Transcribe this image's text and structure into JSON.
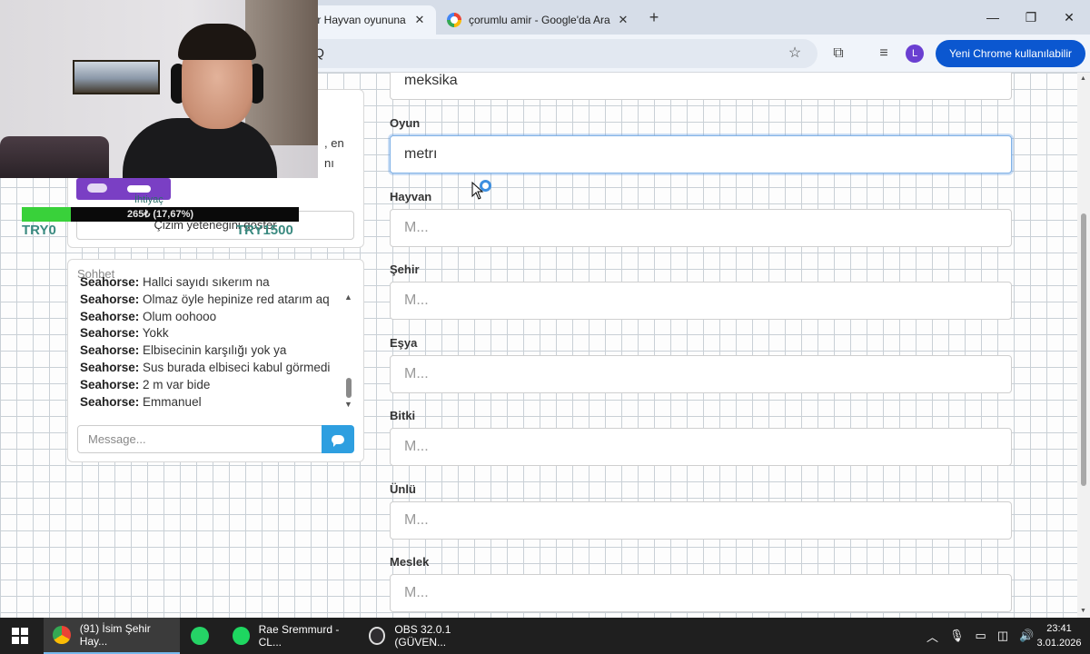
{
  "browser": {
    "tabs": [
      {
        "title": "hir Hayvan oyununa",
        "active": true
      },
      {
        "title": "çorumlu amir - Google'da Ara",
        "active": false
      }
    ],
    "address": "Q",
    "update_button": "Yeni Chrome kullanılabilir",
    "profile_initial": "L",
    "accent_color": "#0b57d0"
  },
  "info_panel": {
    "text_line1": ", en",
    "text_line2": "nı",
    "draw_skill_button": "Çizim yeteneğini göster"
  },
  "chat": {
    "title": "Sohbet",
    "messages": [
      {
        "user": "Seahorse:",
        "text": "Hallci sayıdı sıkerım na"
      },
      {
        "user": "Seahorse:",
        "text": "Olmaz öyle hepinize red atarım aq"
      },
      {
        "user": "Seahorse:",
        "text": "Olum oohooo"
      },
      {
        "user": "Seahorse:",
        "text": "Yokk"
      },
      {
        "user": "Seahorse:",
        "text": "Elbisecinin karşılığı yok ya"
      },
      {
        "user": "Seahorse:",
        "text": "Sus burada elbiseci kabul görmedi"
      },
      {
        "user": "Seahorse:",
        "text": "2 m var bide"
      },
      {
        "user": "Seahorse:",
        "text": "Emmanuel"
      }
    ],
    "input_placeholder": "Message...",
    "send_color": "#2e9fe0"
  },
  "form": {
    "top_value": "meksika",
    "fields": [
      {
        "label": "Oyun",
        "value": "metrı",
        "placeholder": "",
        "focused": true
      },
      {
        "label": "Hayvan",
        "value": "",
        "placeholder": "M..."
      },
      {
        "label": "Şehir",
        "value": "",
        "placeholder": "M..."
      },
      {
        "label": "Eşya",
        "value": "",
        "placeholder": "M..."
      },
      {
        "label": "Bitki",
        "value": "",
        "placeholder": "M..."
      },
      {
        "label": "Ünlü",
        "value": "",
        "placeholder": "M..."
      },
      {
        "label": "Meslek",
        "value": "",
        "placeholder": "M..."
      }
    ]
  },
  "donation": {
    "need_label": "İhtiyaç",
    "progress_text": "265₺ (17,67%)",
    "progress_fraction": 0.1767,
    "min_label": "TRY0",
    "max_label": "TRY1500",
    "bar_color": "#39d13a"
  },
  "taskbar": {
    "apps": [
      {
        "label": "(91) İsim Şehir Hay...",
        "icon": "chrome-icon",
        "active": true
      },
      {
        "label": "",
        "icon": "whatsapp-icon",
        "active": false
      },
      {
        "label": "Rae Sremmurd - CL...",
        "icon": "spotify-icon",
        "active": false
      },
      {
        "label": "OBS 32.0.1 (GÜVEN...",
        "icon": "obs-icon",
        "active": false
      }
    ],
    "time": "23:41",
    "date": "3.01.2026"
  }
}
